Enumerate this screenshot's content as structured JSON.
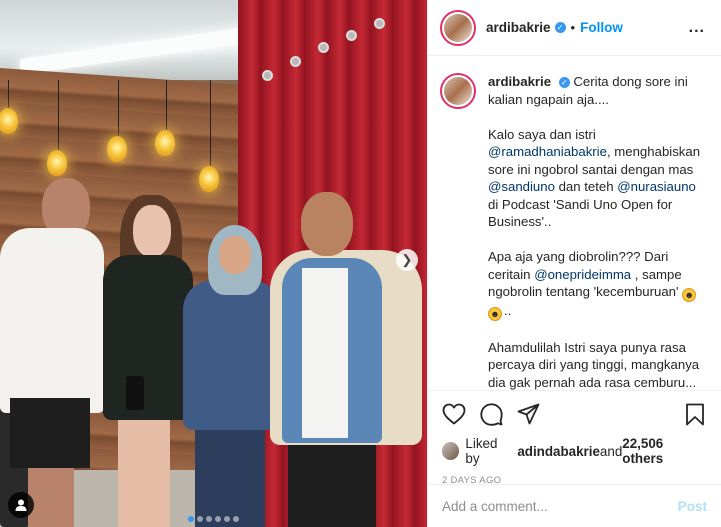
{
  "post": {
    "username": "ardibakrie",
    "follow_label": "Follow",
    "separator": "•",
    "more_label": "...",
    "carousel": {
      "total_slides": 6,
      "active_index": 0
    },
    "caption": {
      "username": "ardibakrie",
      "line1": "Cerita dong sore ini kalian ngapain aja....",
      "p2_a": "Kalo saya dan istri ",
      "mention_1": "@ramadhaniabakrie",
      "p2_b": ", menghabiskan sore ini ngobrol santai dengan mas ",
      "mention_2": "@sandiuno",
      "p2_c": " dan teteh ",
      "mention_3": "@nurasiauno",
      "p2_d": " di Podcast 'Sandi Uno Open for Business'..",
      "p3_a": "Apa aja yang diobrolin??? Dari ceritain ",
      "mention_4": "@oneprideimma",
      "p3_b": " , sampe ngobrolin tentang 'kecemburuan' ",
      "p3_c": "..",
      "p4": "Ahamdulilah Istri saya punya rasa percaya diri yang tinggi, mangkanya dia gak pernah ada rasa cemburu... tapi, ada masukan dari teteh"
    },
    "likes": {
      "prefix": "Liked by ",
      "user": "adindabakrie",
      "middle": " and ",
      "others": "22,506 others"
    },
    "timestamp": "2 DAYS AGO",
    "comment_placeholder": "Add a comment...",
    "post_label": "Post"
  },
  "icons": {
    "like": "heart-icon",
    "comment": "comment-icon",
    "share": "share-icon",
    "save": "bookmark-icon",
    "next": "chevron-right-icon",
    "tag": "user-tag-icon",
    "emoji": "rolling-laughing-emoji"
  },
  "colors": {
    "link": "#00376b",
    "follow": "#0095f6",
    "active_dot": "#3897f0",
    "post_disabled": "#b2dffc",
    "muted": "#8e8e8e"
  }
}
